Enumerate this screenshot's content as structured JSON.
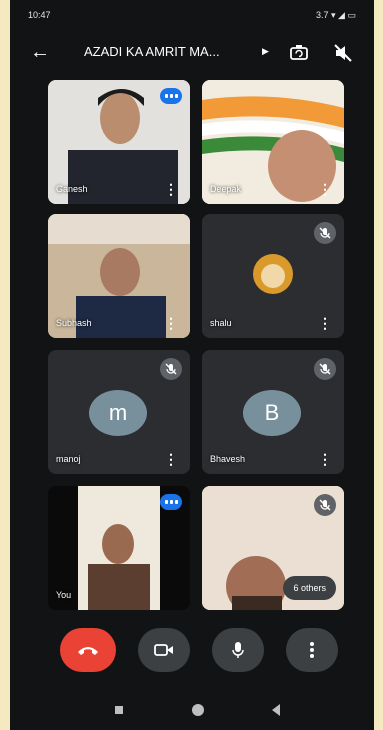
{
  "status_bar": {
    "time": "10:47",
    "right": "3.7 ▾ ◢ ▭"
  },
  "header": {
    "title": "AZADI KA AMRIT MA...",
    "title_icon": "chevron-right-icon",
    "camera_switch_icon": "switch-camera-icon",
    "audio_icon": "speaker-off-icon"
  },
  "participants": [
    {
      "name": "Ganesh"
    },
    {
      "name": "Deepak"
    },
    {
      "name": "Subhash"
    },
    {
      "name": "shalu"
    },
    {
      "name": "manoj",
      "avatar_letter": "m"
    },
    {
      "name": "Bhavesh",
      "avatar_letter": "B"
    },
    {
      "name": "You"
    },
    {
      "name": "",
      "overflow": "6 others"
    }
  ],
  "controls": {
    "end_call_icon": "end-call-icon",
    "camera_icon": "camera-icon",
    "mic_icon": "mic-icon",
    "more_icon": "more-vert-icon"
  },
  "colors": {
    "end_call": "#ea4335",
    "accent_blue": "#1a73e8",
    "tile": "#2b2d31",
    "avatar": "#78909c",
    "page_border": "#f5e9bf"
  }
}
